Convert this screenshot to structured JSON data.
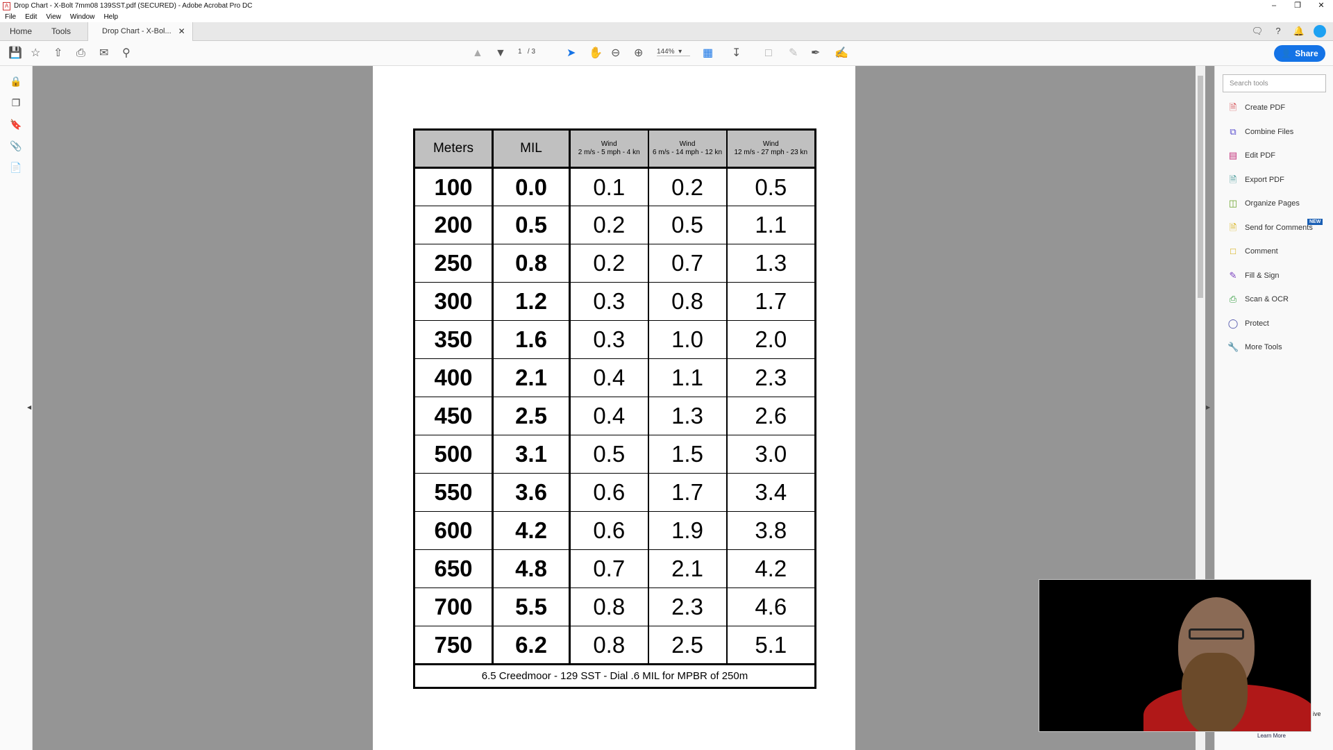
{
  "window": {
    "title": "Drop Chart - X-Bolt 7mm08 139SST.pdf (SECURED) - Adobe Acrobat Pro DC"
  },
  "menu": [
    "File",
    "Edit",
    "View",
    "Window",
    "Help"
  ],
  "tabs": {
    "home": "Home",
    "tools": "Tools",
    "document": "Drop Chart - X-Bol..."
  },
  "toolbar": {
    "page_current": "1",
    "page_total": "/ 3",
    "zoom": "144%",
    "share": "Share"
  },
  "table": {
    "headers": [
      "Meters",
      "MIL",
      "Wind\n2 m/s - 5 mph - 4 kn",
      "Wind\n6 m/s - 14 mph - 12 kn",
      "Wind\n12 m/s - 27 mph - 23 kn"
    ],
    "rows": [
      [
        "100",
        "0.0",
        "0.1",
        "0.2",
        "0.5"
      ],
      [
        "200",
        "0.5",
        "0.2",
        "0.5",
        "1.1"
      ],
      [
        "250",
        "0.8",
        "0.2",
        "0.7",
        "1.3"
      ],
      [
        "300",
        "1.2",
        "0.3",
        "0.8",
        "1.7"
      ],
      [
        "350",
        "1.6",
        "0.3",
        "1.0",
        "2.0"
      ],
      [
        "400",
        "2.1",
        "0.4",
        "1.1",
        "2.3"
      ],
      [
        "450",
        "2.5",
        "0.4",
        "1.3",
        "2.6"
      ],
      [
        "500",
        "3.1",
        "0.5",
        "1.5",
        "3.0"
      ],
      [
        "550",
        "3.6",
        "0.6",
        "1.7",
        "3.4"
      ],
      [
        "600",
        "4.2",
        "0.6",
        "1.9",
        "3.8"
      ],
      [
        "650",
        "4.8",
        "0.7",
        "2.1",
        "4.2"
      ],
      [
        "700",
        "5.5",
        "0.8",
        "2.3",
        "4.6"
      ],
      [
        "750",
        "6.2",
        "0.8",
        "2.5",
        "5.1"
      ]
    ],
    "footer": "6.5 Creedmoor - 129 SST - Dial .6 MIL for MPBR of 250m"
  },
  "right_panel": {
    "search_placeholder": "Search tools",
    "tools": [
      {
        "label": "Create PDF",
        "color": "#d0393e"
      },
      {
        "label": "Combine Files",
        "color": "#5a4fcf"
      },
      {
        "label": "Edit PDF",
        "color": "#c2307a"
      },
      {
        "label": "Export PDF",
        "color": "#2b8a8a"
      },
      {
        "label": "Organize Pages",
        "color": "#6aa32a"
      },
      {
        "label": "Send for Comments",
        "color": "#d4a900"
      },
      {
        "label": "Comment",
        "color": "#d4a900"
      },
      {
        "label": "Fill & Sign",
        "color": "#7a3fbf"
      },
      {
        "label": "Scan & OCR",
        "color": "#2f9a3a"
      },
      {
        "label": "Protect",
        "color": "#4a4fa8"
      },
      {
        "label": "More Tools",
        "color": "#444444"
      }
    ],
    "new_badge": "NEW",
    "learn_more": "Learn More",
    "partial_text": "ive"
  }
}
